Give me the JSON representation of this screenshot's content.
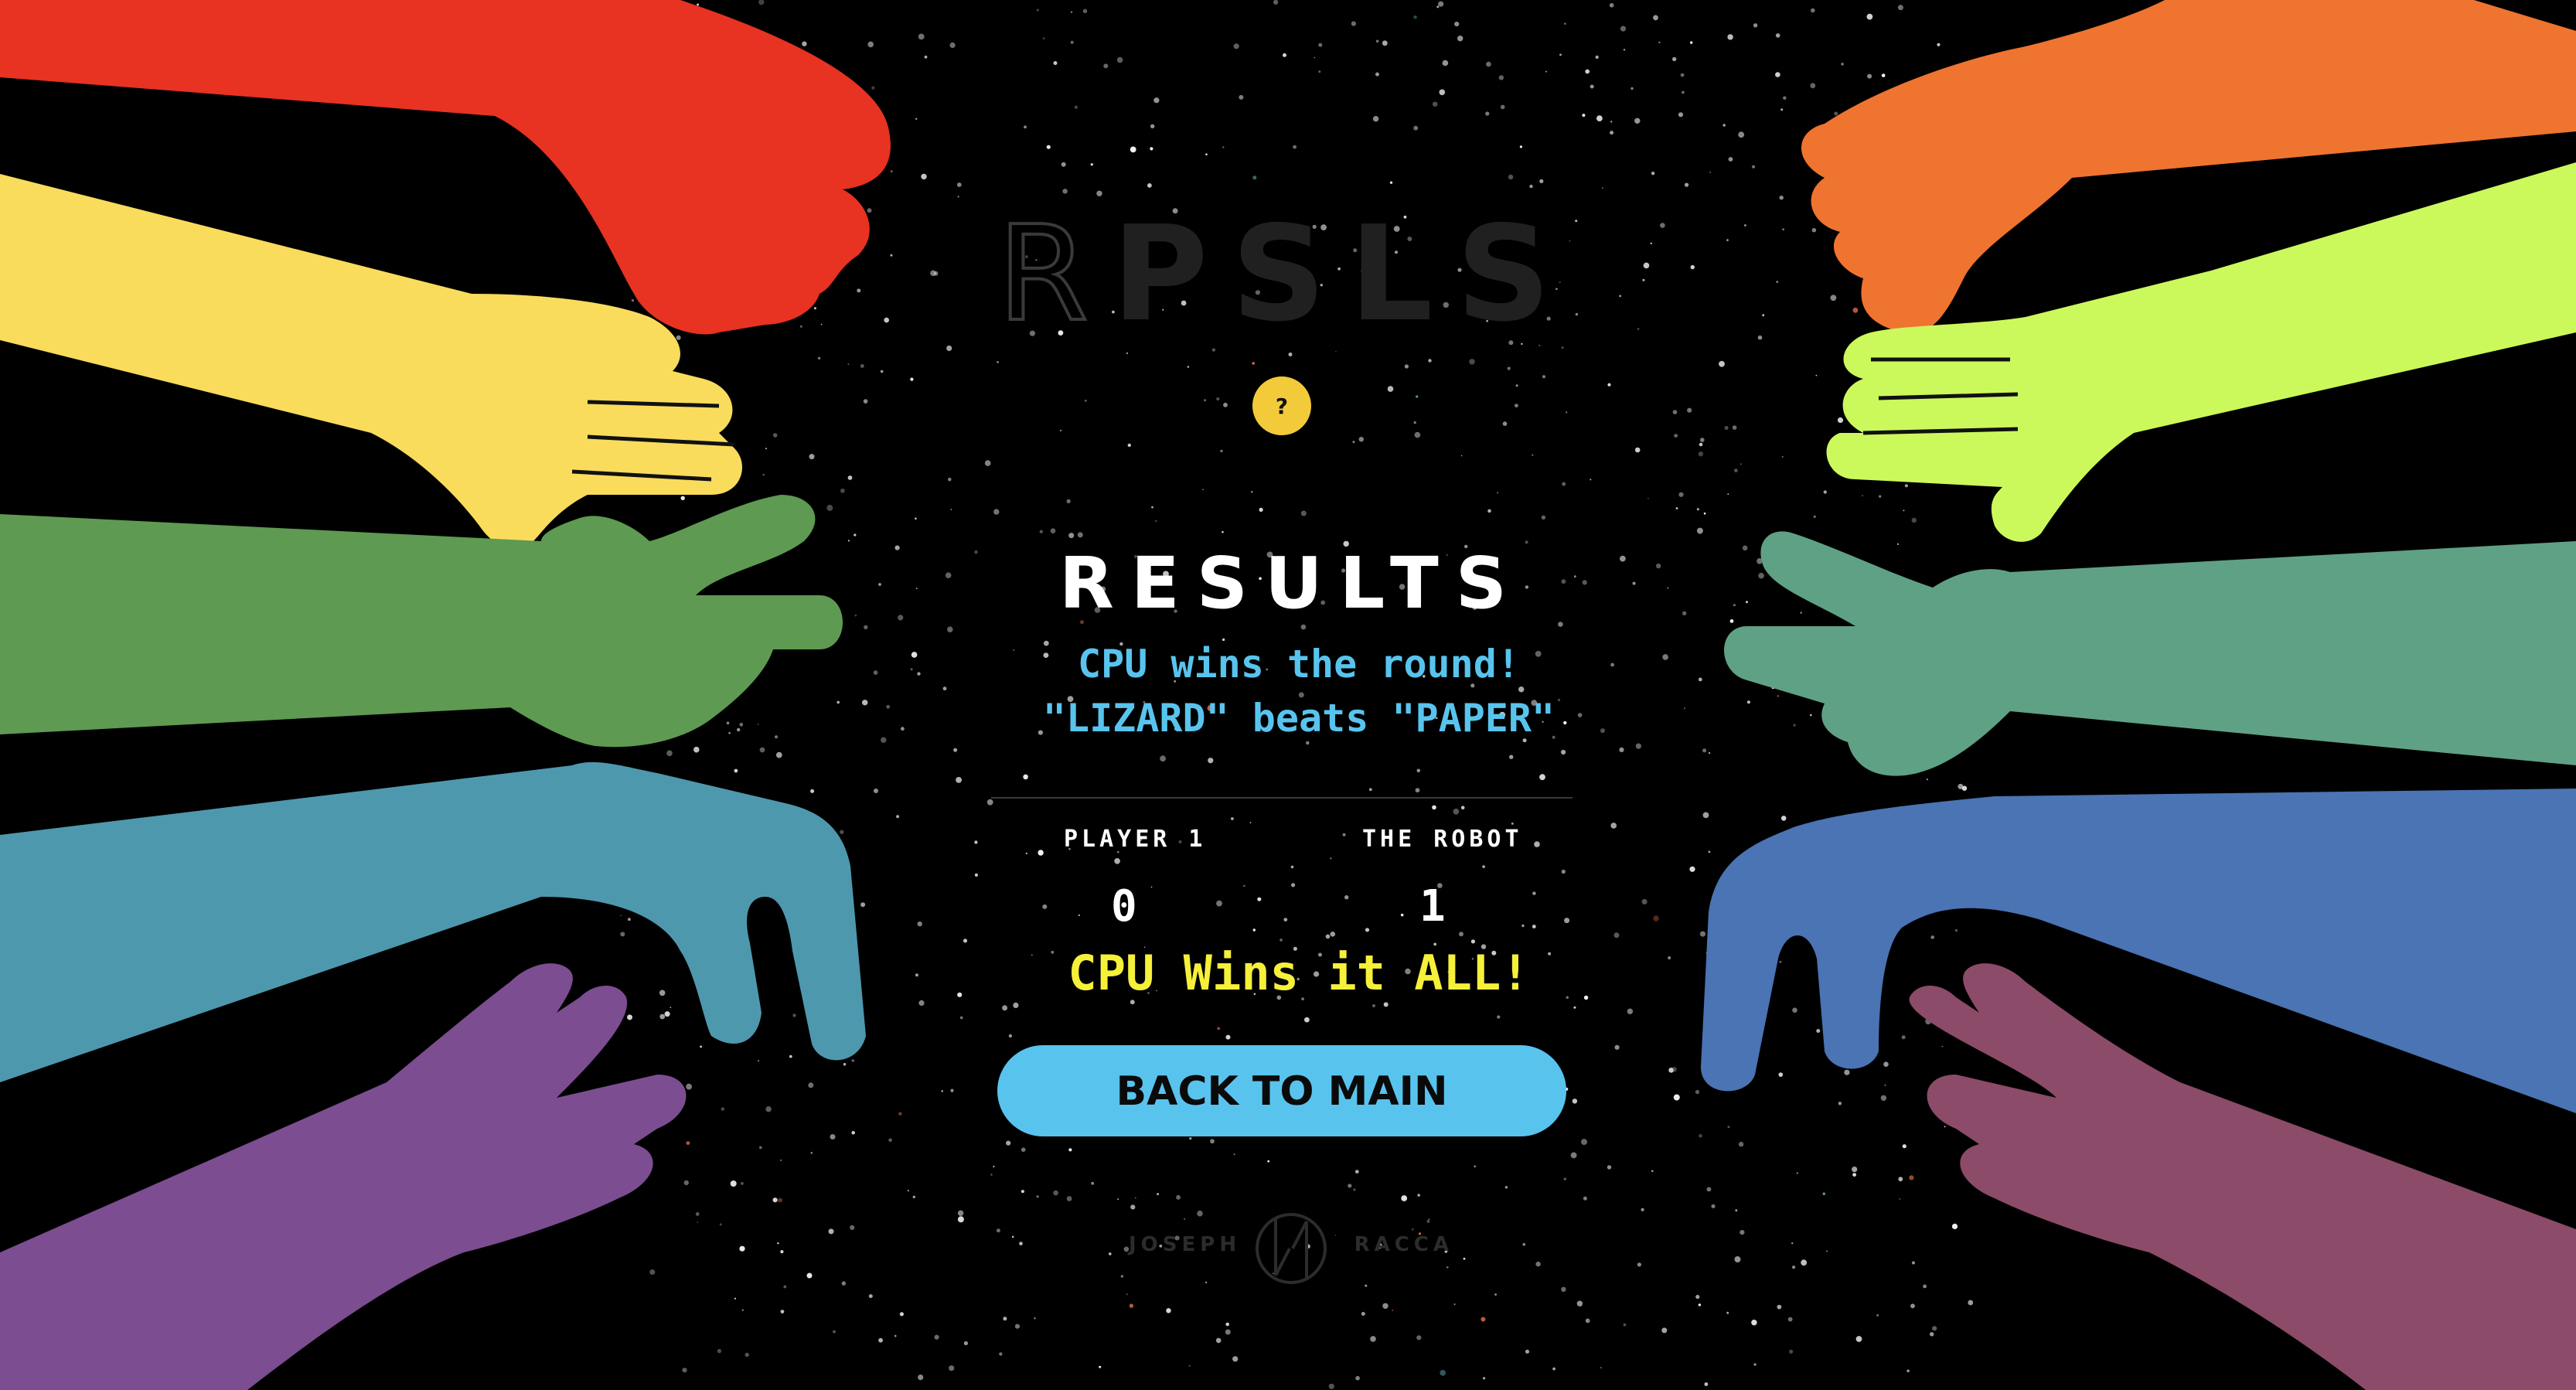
{
  "logo": {
    "first": "R",
    "rest": "PSLS"
  },
  "help_button": {
    "label": "?"
  },
  "results": {
    "title": "RESULTS",
    "round_message": "CPU wins the round!",
    "beats_message": "\"LIZARD\" beats \"PAPER\""
  },
  "scores": {
    "player_label": "PLAYER 1",
    "player_score": "0",
    "robot_label": "THE ROBOT",
    "robot_score": "1"
  },
  "final_message": "CPU Wins it ALL!",
  "back_button": {
    "label": "BACK TO MAIN"
  },
  "signature": {
    "first": "JOSEPH",
    "last": "RACCA"
  },
  "colors": {
    "background": "#000000",
    "accent_blue": "#58c4ee",
    "accent_yellow": "#f5f03a",
    "help_yellow": "#f3cb3a",
    "hand_red": "#e83222",
    "hand_yellow": "#f9dc5c",
    "hand_green": "#5e9a51",
    "hand_teal": "#4e98ae",
    "hand_purple": "#7c4d90",
    "hand_orange": "#ef7430",
    "hand_lime": "#cbf95c",
    "hand_seagreen": "#5fa184",
    "hand_blue": "#4a74b3",
    "hand_plum": "#8c4b68"
  }
}
